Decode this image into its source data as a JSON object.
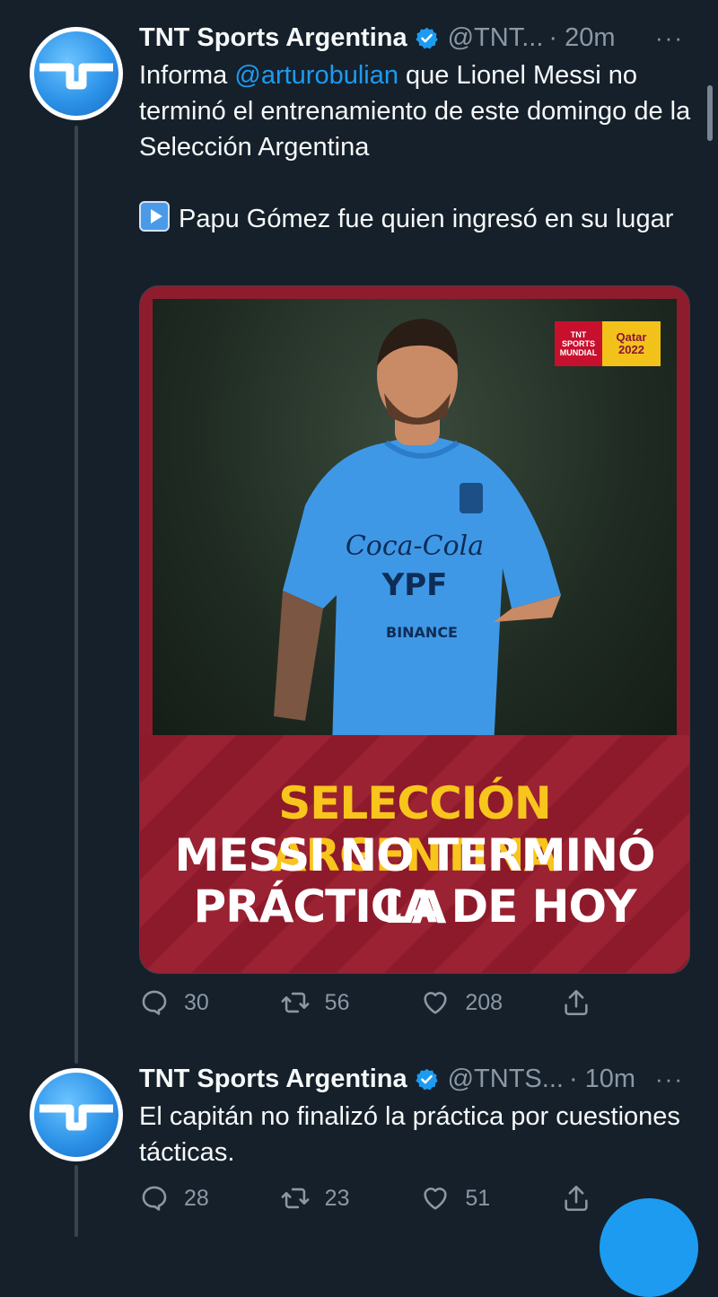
{
  "tweet1": {
    "name": "TNT Sports Argentina",
    "handle": "@TNT...",
    "time": "· 20m",
    "more": "···",
    "text_prefix": "Informa ",
    "mention": "@arturobulian",
    "text_suffix": " que Lionel Messi no terminó el entrenamiento de este domingo de la Selección Argentina",
    "text_line2": "Papu Gómez fue quien ingresó en su lugar",
    "media": {
      "badge_left_1": "TNT",
      "badge_left_2": "SPORTS",
      "badge_left_3": "MUNDIAL",
      "badge_right_1": "Qatar",
      "badge_right_2": "2022",
      "headline_1": "SELECCIÓN ARGENTINA",
      "headline_2": "MESSI NO TERMINÓ LA",
      "headline_3": "PRÁCTICA DE HOY",
      "jersey_sponsor_1": "Coca-Cola",
      "jersey_sponsor_2": "YPF",
      "jersey_sponsor_3": "BINANCE"
    },
    "replies": "30",
    "retweets": "56",
    "likes": "208"
  },
  "tweet2": {
    "name": "TNT Sports Argentina",
    "handle": "@TNTS...",
    "time": "· 10m",
    "more": "···",
    "text": "El capitán no finalizó la práctica por cuestiones tácticas.",
    "replies": "28",
    "retweets": "23",
    "likes": "51"
  },
  "colors": {
    "background": "#15202b",
    "accent": "#1d9bf0",
    "muted": "#8b98a5",
    "banner_red": "#8f1c2c",
    "headline_yellow": "#f8c51c"
  }
}
